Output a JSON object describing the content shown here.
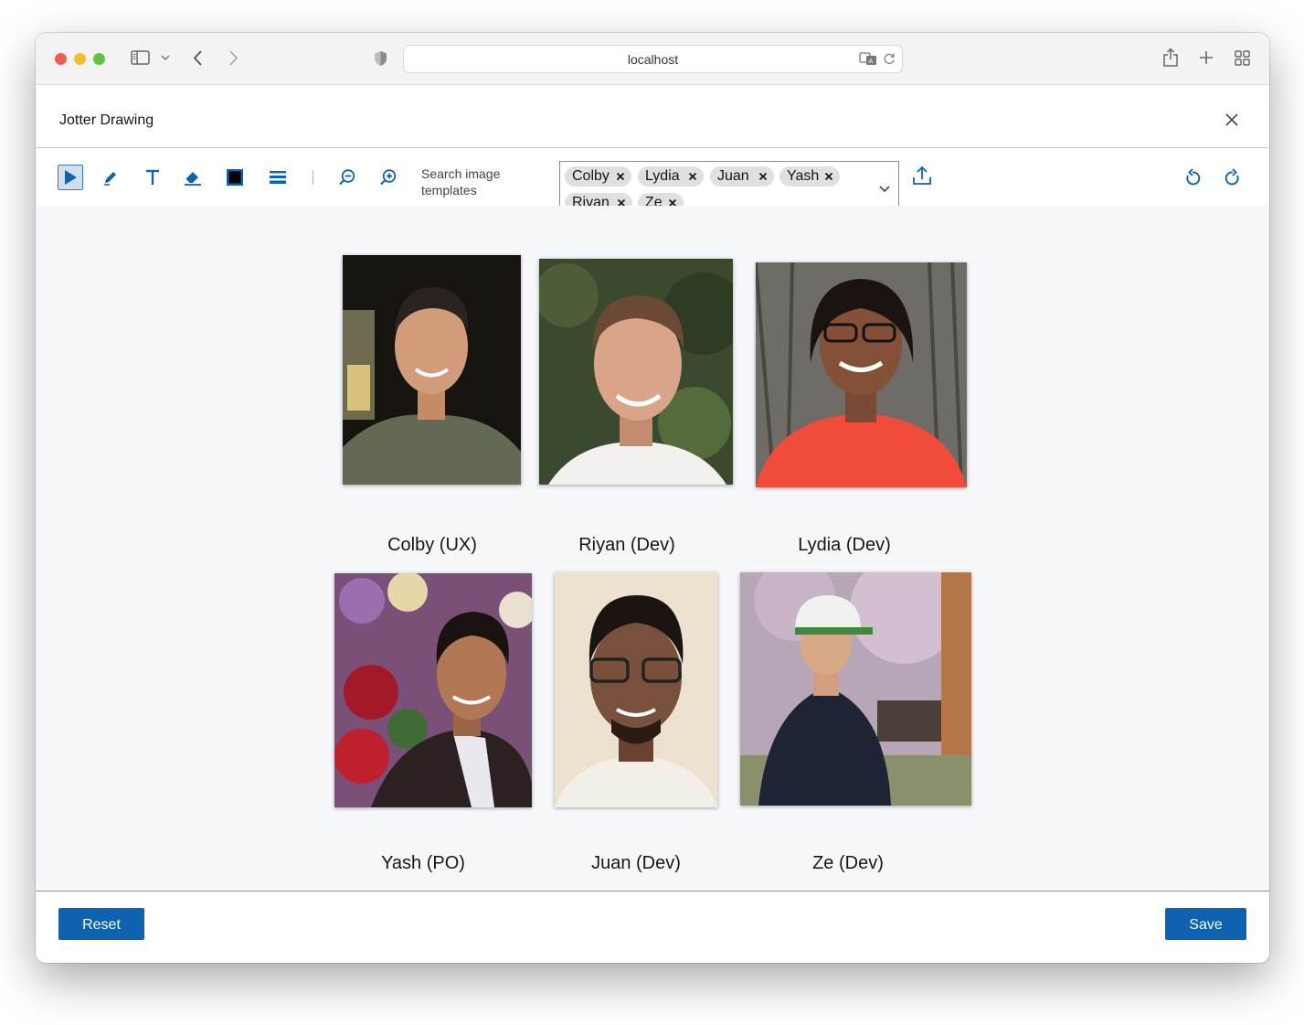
{
  "browser": {
    "url": "localhost",
    "icons": [
      "sidebar-icon",
      "chevron-down-icon",
      "back-icon",
      "forward-icon",
      "shield-icon",
      "translate-icon",
      "reload-icon",
      "share-icon",
      "new-tab-icon",
      "tab-overview-icon"
    ]
  },
  "app": {
    "title": "Jotter Drawing"
  },
  "toolbar": {
    "tools": [
      "select-tool",
      "pencil-tool",
      "text-tool",
      "eraser-tool",
      "color-swatch",
      "line-weight-tool",
      "zoom-out-tool",
      "zoom-in-tool"
    ],
    "search_label": "Search image templates",
    "selected_chips": [
      "Colby",
      "Lydia",
      "Juan",
      "Yash",
      "Riyan",
      "Ze"
    ],
    "accent_color": "#0f62b0"
  },
  "canvas": {
    "people": [
      {
        "caption": "Colby (UX)"
      },
      {
        "caption": "Riyan (Dev)"
      },
      {
        "caption": "Lydia (Dev)"
      },
      {
        "caption": "Yash (PO)"
      },
      {
        "caption": "Juan (Dev)"
      },
      {
        "caption": "Ze (Dev)"
      }
    ]
  },
  "footer": {
    "reset_label": "Reset",
    "save_label": "Save"
  }
}
